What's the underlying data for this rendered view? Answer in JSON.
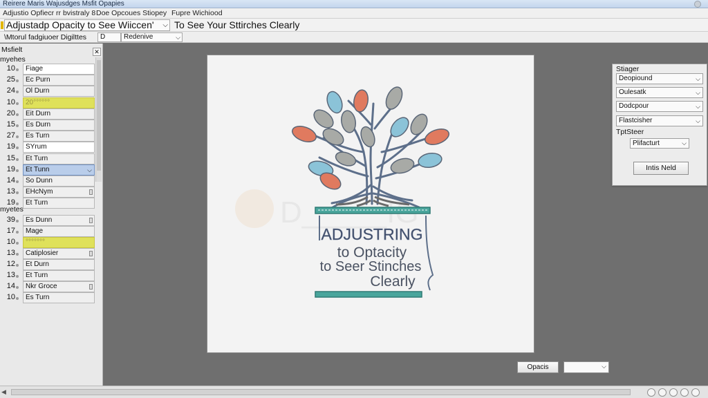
{
  "window": {
    "title": "Reirere Maris Wajusdges Msfit Opapies"
  },
  "menubar": {
    "items": [
      "Adjustio Opfiecr rr bvistraly 8",
      "Doe Opcoues Stiopey",
      "Fupre Wichiood"
    ]
  },
  "toolbar": {
    "combo_value": "Adjustadp Opacity to See Wiiccen'",
    "heading": "To See Your Sttirches Clearly"
  },
  "subbar": {
    "label": "\\Mtorul fadgiuoer Digilttes",
    "button_label": "D",
    "select_value": "Redenive"
  },
  "left_panel": {
    "title": "Msfielt",
    "group1_label": "myehes",
    "group1_rows": [
      {
        "num": "10",
        "label": "Fiage"
      },
      {
        "num": "25",
        "label": "Ec Purn"
      },
      {
        "num": "24",
        "label": "Ol Durn"
      },
      {
        "num": "10",
        "label": "20°°°°°°"
      },
      {
        "num": "20",
        "label": "Eit Durn"
      },
      {
        "num": "15",
        "label": "Es Durn"
      },
      {
        "num": "27",
        "label": "Es Turn"
      },
      {
        "num": "19",
        "label": "SYrum"
      },
      {
        "num": "15",
        "label": "Et Turn"
      },
      {
        "num": "19",
        "label": "Et Tunn"
      },
      {
        "num": "14",
        "label": "So Dunn"
      },
      {
        "num": "13",
        "label": "EHcNym"
      },
      {
        "num": "19",
        "label": "Et Turn"
      }
    ],
    "group2_label": "myetes",
    "group2_rows": [
      {
        "num": "39",
        "label": "Es Dunn"
      },
      {
        "num": "17",
        "label": "Mage"
      },
      {
        "num": "10",
        "label": "°°°°°°°"
      },
      {
        "num": "13",
        "label": "Catiplosier"
      },
      {
        "num": "12",
        "label": "Et Durn"
      },
      {
        "num": "13",
        "label": "Et Turn"
      },
      {
        "num": "14",
        "label": "Nkr Groce"
      },
      {
        "num": "10",
        "label": "Es Turn"
      }
    ]
  },
  "canvas": {
    "watermark": "D_____IG",
    "text_line1": "ADJUSTRING",
    "text_line2": "to Optacity",
    "text_line3": "to Seer Stinches",
    "text_line4": "Clearly"
  },
  "props_panel": {
    "title": "Stiager",
    "select1": "Deopiound",
    "select2": "Oulesatk",
    "select3": "Dodcpour",
    "select4": "Flastcisher",
    "label2": "TptSteer",
    "small_select": "Plifacturt",
    "button": "Intis Neld"
  },
  "bottom": {
    "opacity_button": "Opacis"
  },
  "colors": {
    "highlight": "#dfe15a",
    "selection": "#b9cdea",
    "canvas_bg": "#f3f3f3",
    "workspace_bg": "#6f6f6f",
    "leaf_blue": "#8bc3d8",
    "leaf_coral": "#e07a5f",
    "leaf_gray": "#a8aaa6",
    "pot_teal": "#49a59c"
  }
}
